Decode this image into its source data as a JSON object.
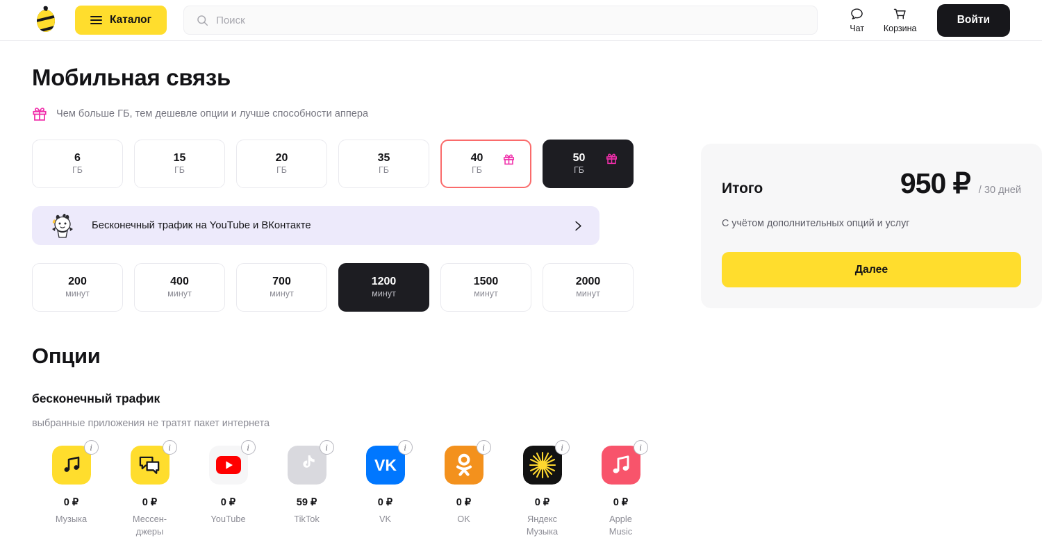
{
  "header": {
    "logo_icon": "beeline-logo",
    "catalog_label": "Каталог",
    "menu_icon": "burger-menu-icon",
    "search": {
      "icon": "search-icon",
      "placeholder": "Поиск",
      "value": ""
    },
    "chat_label": "Чат",
    "chat_icon": "chat-bubble-icon",
    "cart_label": "Корзина",
    "cart_icon": "shopping-cart-icon",
    "login_label": "Войти"
  },
  "main": {
    "page_title": "Мобильная связь",
    "gift_note": {
      "icon": "gift-icon",
      "text": "Чем больше ГБ, тем дешевле опции и лучше способности аппера"
    },
    "data_tiles": [
      {
        "value": "6",
        "unit": "ГБ",
        "state": "default",
        "gift": false
      },
      {
        "value": "15",
        "unit": "ГБ",
        "state": "default",
        "gift": false
      },
      {
        "value": "20",
        "unit": "ГБ",
        "state": "default",
        "gift": false
      },
      {
        "value": "35",
        "unit": "ГБ",
        "state": "default",
        "gift": false
      },
      {
        "value": "40",
        "unit": "ГБ",
        "state": "hovered",
        "gift": true
      },
      {
        "value": "50",
        "unit": "ГБ",
        "state": "selected",
        "gift": true
      }
    ],
    "promo_banner": {
      "mascot_icon": "mascot-icon",
      "text": "Бесконечный трафик на YouTube и ВКонтакте",
      "chevron_icon": "chevron-right-icon"
    },
    "minute_tiles": [
      {
        "value": "200",
        "unit": "минут",
        "state": "default"
      },
      {
        "value": "400",
        "unit": "минут",
        "state": "default"
      },
      {
        "value": "700",
        "unit": "минут",
        "state": "default"
      },
      {
        "value": "1200",
        "unit": "минут",
        "state": "selected"
      },
      {
        "value": "1500",
        "unit": "минут",
        "state": "default"
      },
      {
        "value": "2000",
        "unit": "минут",
        "state": "default"
      }
    ],
    "options_title": "Опции",
    "unlimited_title": "бесконечный трафик",
    "unlimited_desc": "выбранные приложения не тратят пакет интернета",
    "apps": [
      {
        "name": "Музыка",
        "price": "0 ₽",
        "icon": "music-note-icon",
        "info_icon": "info-icon"
      },
      {
        "name": "Мессен-\nджеры",
        "price": "0 ₽",
        "icon": "messengers-icon",
        "info_icon": "info-icon"
      },
      {
        "name": "YouTube",
        "price": "0 ₽",
        "icon": "youtube-icon",
        "info_icon": "info-icon"
      },
      {
        "name": "TikTok",
        "price": "59 ₽",
        "icon": "tiktok-icon",
        "info_icon": "info-icon"
      },
      {
        "name": "VK",
        "price": "0 ₽",
        "icon": "vk-icon",
        "info_icon": "info-icon"
      },
      {
        "name": "OK",
        "price": "0 ₽",
        "icon": "ok-icon",
        "info_icon": "info-icon"
      },
      {
        "name": "Яндекс\nМузыка",
        "price": "0 ₽",
        "icon": "yandex-music-icon",
        "info_icon": "info-icon"
      },
      {
        "name": "Apple\nMusic",
        "price": "0 ₽",
        "icon": "apple-music-icon",
        "info_icon": "info-icon"
      }
    ]
  },
  "summary": {
    "label": "Итого",
    "price": "950 ₽",
    "period": "/ 30 дней",
    "note": "С учётом дополнительных опций и услуг",
    "next_label": "Далее"
  },
  "colors": {
    "brand_yellow": "#ffdd2d",
    "dark": "#1d1d22",
    "gift_pink": "#f02eaa",
    "hover_red": "#fa6b6b",
    "promo_lilac": "#edeafb",
    "muted_text": "#8b8b94"
  }
}
